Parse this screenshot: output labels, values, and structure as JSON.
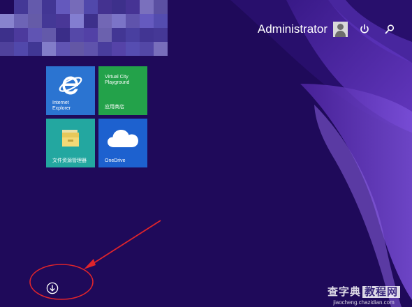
{
  "header": {
    "user_name": "Administrator",
    "avatar_icon": "user-avatar-icon",
    "power_icon": "power-icon",
    "search_icon": "search-icon"
  },
  "tiles": [
    {
      "id": "internet-explorer",
      "label": "Internet\nExplorer",
      "icon": "internet-explorer-icon",
      "color": "#2b74d1"
    },
    {
      "id": "store",
      "label": "Virtual City\nPlayground",
      "sublabel": "应用商店",
      "color": "#23a24a"
    },
    {
      "id": "file-explorer",
      "label": "文件资源管理器",
      "icon": "folder-icon",
      "color": "#23a7a0"
    },
    {
      "id": "onedrive",
      "label": "OneDrive",
      "icon": "cloud-icon",
      "color": "#1d61cf"
    }
  ],
  "footer": {
    "all_apps_icon": "down-arrow-circle-icon"
  },
  "watermark": {
    "line1_a": "查字典",
    "line1_b": "教程网",
    "line2": "jiaocheng.chazidian.com"
  },
  "colors": {
    "background": "#1f0a5a",
    "accent_purple": "#5a2fb0",
    "annotation": "#e0242b"
  }
}
